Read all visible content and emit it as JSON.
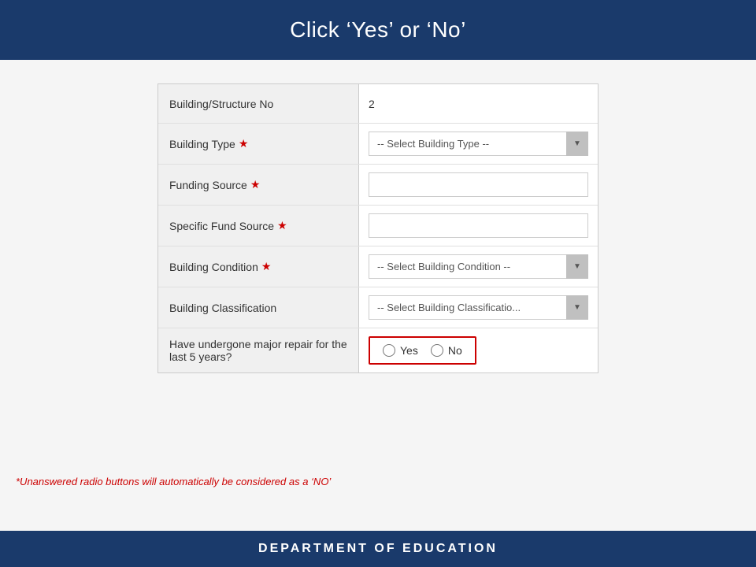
{
  "header": {
    "title": "Click ‘Yes’ or ‘No’"
  },
  "form": {
    "rows": [
      {
        "id": "building-structure-no",
        "label": "Building/Structure No",
        "required": false,
        "type": "static",
        "value": "2"
      },
      {
        "id": "building-type",
        "label": "Building Type",
        "required": true,
        "type": "select",
        "placeholder": "-- Select Building Type --",
        "options": [
          "-- Select Building Type --"
        ]
      },
      {
        "id": "funding-source",
        "label": "Funding Source",
        "required": true,
        "type": "text",
        "value": "",
        "placeholder": ""
      },
      {
        "id": "specific-fund-source",
        "label": "Specific Fund Source",
        "required": true,
        "type": "text",
        "value": "",
        "placeholder": ""
      },
      {
        "id": "building-condition",
        "label": "Building Condition",
        "required": true,
        "type": "select",
        "placeholder": "-- Select Building Condition --",
        "options": [
          "-- Select Building Condition --"
        ]
      },
      {
        "id": "building-classification",
        "label": "Building Classification",
        "required": false,
        "type": "select",
        "placeholder": "-- Select Building Classificatio...",
        "options": [
          "-- Select Building Classificatio..."
        ]
      },
      {
        "id": "major-repair",
        "label": "Have undergone major repair for the last 5 years?",
        "required": false,
        "type": "radio",
        "options": [
          {
            "value": "yes",
            "label": "Yes"
          },
          {
            "value": "no",
            "label": "No"
          }
        ]
      }
    ]
  },
  "note": "*Unanswered radio buttons will automatically be considered as a ‘NO’",
  "footer": {
    "text": "Department of Education"
  },
  "icons": {
    "dropdown_arrow": "▼"
  }
}
